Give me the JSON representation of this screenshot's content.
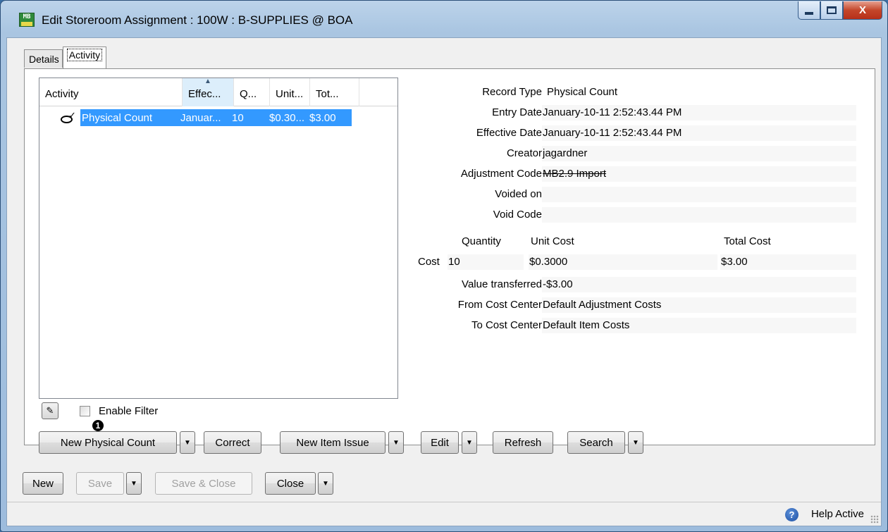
{
  "window": {
    "title": "Edit Storeroom Assignment : 100W : B-SUPPLIES @ BOA",
    "app_icon_text": "MB",
    "close_glyph": "X"
  },
  "tabs": [
    {
      "label": "Details",
      "active": false
    },
    {
      "label": "Activity",
      "active": true
    }
  ],
  "activity_list": {
    "columns": [
      "Activity",
      "Effec...",
      "Q...",
      "Unit...",
      "Tot..."
    ],
    "sorted_column": "Effec...",
    "rows": [
      {
        "activity": "Physical Count",
        "effective": "Januar...",
        "quantity": "10",
        "unit": "$0.30...",
        "total": "$3.00",
        "selected": true,
        "icon": "physical-count-icon"
      }
    ]
  },
  "filter": {
    "label": "Enable Filter",
    "checked": false
  },
  "details": {
    "record_type": {
      "label": "Record Type",
      "value": "Physical Count"
    },
    "entry_date": {
      "label": "Entry Date",
      "value": "January-10-11 2:52:43.44 PM"
    },
    "effective_date": {
      "label": "Effective Date",
      "value": "January-10-11 2:52:43.44 PM"
    },
    "creator": {
      "label": "Creator",
      "value": "jagardner"
    },
    "adjustment_code": {
      "label": "Adjustment Code",
      "value": "MB2.9 Import"
    },
    "voided_on": {
      "label": "Voided on",
      "value": ""
    },
    "void_code": {
      "label": "Void Code",
      "value": ""
    },
    "cost_headers": {
      "quantity": "Quantity",
      "unit_cost": "Unit Cost",
      "total_cost": "Total Cost"
    },
    "cost_row": {
      "label": "Cost",
      "quantity": "10",
      "unit_cost": "$0.3000",
      "total_cost": "$3.00"
    },
    "value_transferred": {
      "label": "Value transferred",
      "value": "-$3.00"
    },
    "from_cost_center": {
      "label": "From Cost Center",
      "value": "Default Adjustment Costs"
    },
    "to_cost_center": {
      "label": "To Cost Center",
      "value": "Default Item Costs"
    }
  },
  "action_buttons": {
    "new_physical_count": "New Physical Count",
    "correct": "Correct",
    "new_item_issue": "New Item Issue",
    "edit": "Edit",
    "refresh": "Refresh",
    "search": "Search",
    "badge": "1"
  },
  "bottom_buttons": {
    "new": "New",
    "save": "Save",
    "save_close": "Save & Close",
    "close": "Close"
  },
  "statusbar": {
    "help": "Help",
    "state": "Active"
  },
  "colors": {
    "selection": "#3399ff",
    "close_button": "#c4462a",
    "title_bar": "#a9c5e1"
  }
}
